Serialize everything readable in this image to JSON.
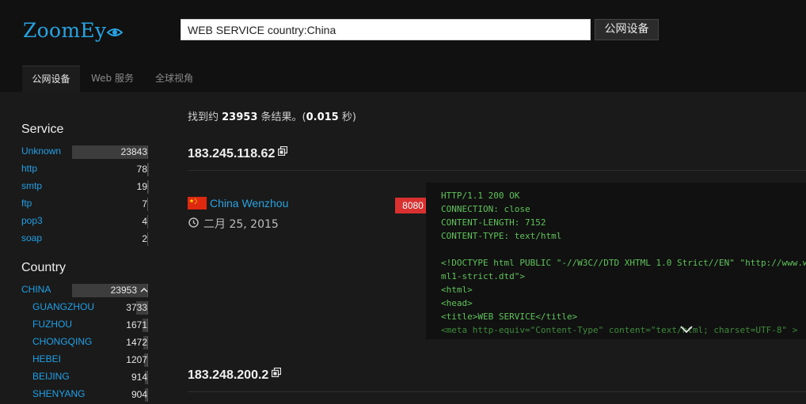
{
  "header": {
    "logo_text": "ZoomEy",
    "search_value": "WEB SERVICE country:China",
    "search_button": "公网设备"
  },
  "tabs": [
    {
      "label": "公网设备",
      "active": true
    },
    {
      "label": "Web 服务",
      "active": false
    },
    {
      "label": "全球视角",
      "active": false
    }
  ],
  "sidebar": {
    "service_heading": "Service",
    "services": [
      {
        "label": "Unknown",
        "count": "23843",
        "share": 1.0
      },
      {
        "label": "http",
        "count": "78",
        "share": 0.003
      },
      {
        "label": "smtp",
        "count": "19",
        "share": 0.001
      },
      {
        "label": "ftp",
        "count": "7",
        "share": 0.0003
      },
      {
        "label": "pop3",
        "count": "4",
        "share": 0.0002
      },
      {
        "label": "soap",
        "count": "2",
        "share": 0.0001
      }
    ],
    "country_heading": "Country",
    "countries": [
      {
        "label": "CHINA",
        "count": "23953",
        "share": 1.0
      }
    ],
    "cities": [
      {
        "label": "GUANGZHOU",
        "count": "3733",
        "share": 0.156
      },
      {
        "label": "FUZHOU",
        "count": "1671",
        "share": 0.07
      },
      {
        "label": "CHONGQING",
        "count": "1472",
        "share": 0.061
      },
      {
        "label": "HEBEI",
        "count": "1207",
        "share": 0.05
      },
      {
        "label": "BEIJING",
        "count": "914",
        "share": 0.038
      },
      {
        "label": "SHENYANG",
        "count": "904",
        "share": 0.038
      }
    ]
  },
  "main": {
    "summary_prefix": "找到约 ",
    "summary_count": "23953",
    "summary_mid": " 条结果。(",
    "summary_time": "0.015",
    "summary_suffix": " 秒)",
    "results": [
      {
        "ip": "183.245.118.62",
        "location": "China Wenzhou",
        "date": "二月 25, 2015",
        "port": "8080",
        "banner": [
          "HTTP/1.1 200 OK",
          "CONNECTION: close",
          "CONTENT-LENGTH: 7152",
          "CONTENT-TYPE: text/html",
          "",
          "<!DOCTYPE html PUBLIC \"-//W3C//DTD XHTML 1.0 Strict//EN\" \"http://www.w",
          "ml1-strict.dtd\">",
          "<html>",
          "<head>",
          "<title>WEB SERVICE</title>",
          "<meta http-equiv=\"Content-Type\" content=\"text/html; charset=UTF-8\" >"
        ]
      },
      {
        "ip": "183.248.200.2"
      }
    ]
  },
  "colors": {
    "accent": "#29a3e0",
    "port_badge": "#d93030",
    "banner_text": "#5fc35a"
  }
}
